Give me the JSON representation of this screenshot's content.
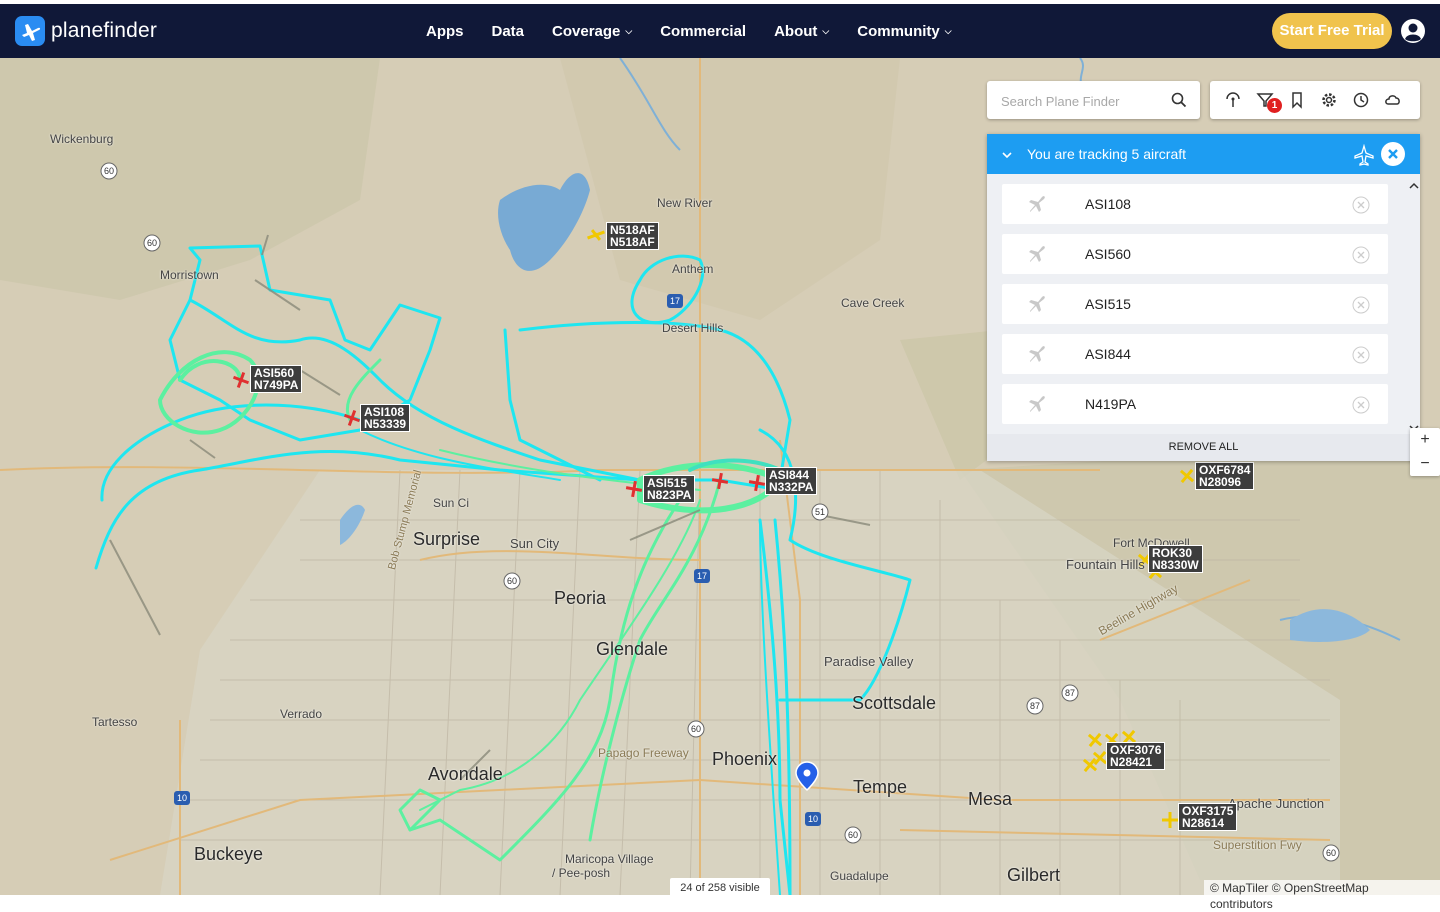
{
  "header": {
    "brand": "planefinder",
    "menu": [
      {
        "label": "Apps",
        "dropdown": false
      },
      {
        "label": "Data",
        "dropdown": false
      },
      {
        "label": "Coverage",
        "dropdown": true
      },
      {
        "label": "Commercial",
        "dropdown": false
      },
      {
        "label": "About",
        "dropdown": true
      },
      {
        "label": "Community",
        "dropdown": true
      }
    ],
    "trial_button": "Start Free Trial",
    "accent": "#f0c34d",
    "bar_color": "#101838"
  },
  "search": {
    "placeholder": "Search Plane Finder"
  },
  "toolbar": {
    "icons": [
      "airport-icon",
      "filter-icon",
      "bookmark-icon",
      "settings-icon",
      "history-icon",
      "cloud-icon"
    ],
    "filter_badge": "1"
  },
  "tracking_panel": {
    "title": "You are tracking 5 aircraft",
    "items": [
      "ASI108",
      "ASI560",
      "ASI515",
      "ASI844",
      "N419PA"
    ],
    "remove_all": "REMOVE ALL",
    "accent": "#1d9df2"
  },
  "zoom": {
    "in": "+",
    "out": "−"
  },
  "map": {
    "visible_count": "24 of 258 visible",
    "attribution": "© MapTiler © OpenStreetMap contributors",
    "places": {
      "wickenburg": "Wickenburg",
      "morristown": "Morristown",
      "new_river": "New River",
      "anthem": "Anthem",
      "desert_hills": "Desert Hills",
      "cave_creek": "Cave Creek",
      "sun_city_west": "Sun Ci",
      "surprise": "Surprise",
      "sun_city": "Sun City",
      "peoria": "Peoria",
      "glendale": "Glendale",
      "paradise_valley": "Paradise Valley",
      "scottsdale": "Scottsdale",
      "tartesso": "Tartesso",
      "verrado": "Verrado",
      "avondale": "Avondale",
      "papago": "Papago Freeway",
      "phoenix": "Phoenix",
      "tempe": "Tempe",
      "mesa": "Mesa",
      "gilbert": "Gilbert",
      "buckeye": "Buckeye",
      "maricopa_village": "Maricopa Village",
      "pee_posh": "/ Pee-posh",
      "guadalupe": "Guadalupe",
      "apache_junction": "Apache Junction",
      "superstition": "Superstition Fwy",
      "fort_mcdowell": "Fort McDowell",
      "fountain_hills": "Fountain Hills",
      "beeline": "Beeline Highway",
      "bob_stump": "Bob Stump Memorial"
    },
    "aircraft": [
      {
        "callsign": "N518AF",
        "reg": "N518AF",
        "color": "#f0c800"
      },
      {
        "callsign": "ASI560",
        "reg": "N749PA",
        "color": "#e03030"
      },
      {
        "callsign": "ASI108",
        "reg": "N53339",
        "color": "#e03030"
      },
      {
        "callsign": "ASI515",
        "reg": "N823PA",
        "color": "#e03030"
      },
      {
        "callsign": "ASI844",
        "reg": "N332PA",
        "color": "#e03030"
      },
      {
        "callsign": "OXF6784",
        "reg": "N28096",
        "color": "#f0c800"
      },
      {
        "callsign": "ROK30",
        "reg": "N8330W",
        "color": "#f0c800"
      },
      {
        "callsign": "OXF3076",
        "reg": "N28421",
        "color": "#f0c800"
      },
      {
        "callsign": "OXF3175",
        "reg": "N28614",
        "color": "#f0c800"
      }
    ],
    "track_colors": {
      "primary": "#1ee6f0",
      "secondary": "#5cf0a0"
    }
  }
}
